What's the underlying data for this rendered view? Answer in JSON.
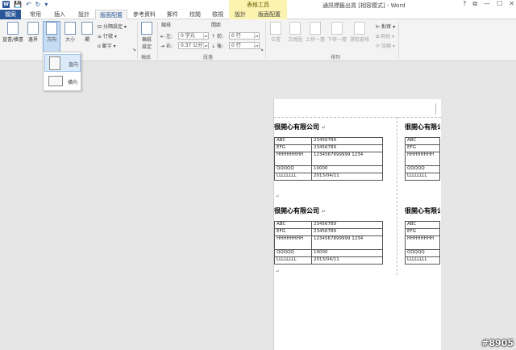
{
  "window": {
    "title": "通訊標籤出貨 [相容模式] - Word",
    "contextual_group": "表格工具",
    "controls": [
      "?",
      "⧉",
      "—",
      "☐",
      "✕"
    ]
  },
  "tabs": [
    {
      "label": "檔案"
    },
    {
      "label": "常用"
    },
    {
      "label": "插入"
    },
    {
      "label": "設計"
    },
    {
      "label": "版面配置"
    },
    {
      "label": "參考資料"
    },
    {
      "label": "郵件"
    },
    {
      "label": "校閱"
    },
    {
      "label": "檢視"
    },
    {
      "label": "設計"
    },
    {
      "label": "版面配置"
    }
  ],
  "ribbon": {
    "page_setup": {
      "direction": "直書/橫書",
      "margins": "邊界",
      "orientation": "方向",
      "size": "大小",
      "columns": "欄",
      "breaks": "分隔設定",
      "line_numbers": "行號",
      "hyphenation": "斷字"
    },
    "manuscript": {
      "button": "稿紙\n設定",
      "group": "稿紙"
    },
    "paragraph": {
      "indent_label": "縮排",
      "spacing_label": "間距",
      "left_label": "左:",
      "left_value": "0 字元",
      "right_label": "右:",
      "right_value": "0.37 公分",
      "before_label": "前:",
      "before_value": "0 行",
      "after_label": "後:",
      "after_value": "0 行",
      "group": "段落"
    },
    "arrange": {
      "position": "位置",
      "wrap_text": "文繞圖",
      "bring_forward": "上移一層",
      "send_backward": "下移一層",
      "selection_pane": "選取窗格",
      "align": "對齊",
      "group_objects": "群組",
      "rotate": "旋轉",
      "group": "排列"
    }
  },
  "orientation_dropdown": {
    "items": [
      {
        "label": "直向"
      },
      {
        "label": "橫向"
      }
    ]
  },
  "document": {
    "cards": [
      {
        "company": "很開心有限公司",
        "rows": [
          [
            "ABC",
            "23456789"
          ],
          [
            "EFG",
            "23456789"
          ],
          [
            "HHHHHHHH",
            "1234567899999 1234"
          ],
          [
            "QQQQQ",
            "10000"
          ],
          [
            "LLLLLLLL",
            "2013/04/11"
          ]
        ]
      },
      {
        "company": "很開心有限公司",
        "rows": [
          [
            "ABC",
            "23456789"
          ],
          [
            "EFG",
            "23456789"
          ],
          [
            "HHHHHHHH",
            "1234567899999 1234"
          ],
          [
            "QQQQQ",
            "10000"
          ],
          [
            "LLLLLLLL",
            "2013/04/11"
          ]
        ]
      },
      {
        "company": "很開心有限公司",
        "rows": [
          [
            "ABC",
            ""
          ],
          [
            "EFG",
            ""
          ],
          [
            "HHHHHHHH",
            ""
          ],
          [
            "QQQQQ",
            ""
          ],
          [
            "LLLLLLLL",
            ""
          ]
        ]
      },
      {
        "company": "很開心有限公司",
        "rows": [
          [
            "ABC",
            ""
          ],
          [
            "EFG",
            ""
          ],
          [
            "HHHHHHHH",
            ""
          ],
          [
            "QQQQQ",
            ""
          ],
          [
            "LLLLLLLL",
            ""
          ]
        ]
      }
    ],
    "para_mark": "↵"
  },
  "watermark": "#8905"
}
